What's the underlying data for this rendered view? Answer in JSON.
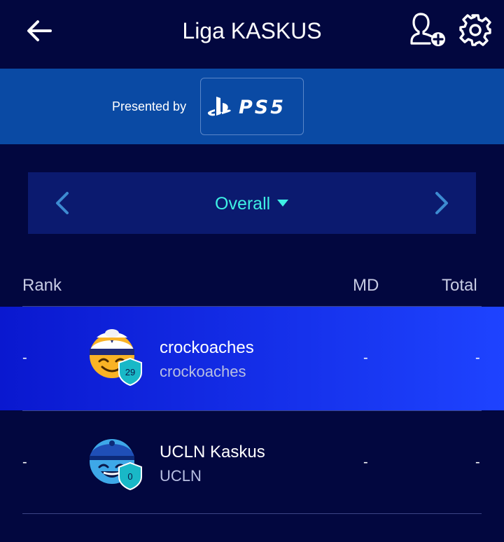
{
  "header": {
    "title": "Liga KASKUS",
    "icons": [
      "arrow-left-icon",
      "add-user-icon",
      "gear-icon"
    ]
  },
  "sponsor": {
    "presented_by": "Presented by",
    "logo_text": "PS5"
  },
  "selector": {
    "label": "Overall"
  },
  "table": {
    "columns": [
      "Rank",
      "MD",
      "Total"
    ],
    "rows": [
      {
        "rank": "-",
        "name": "crockoaches",
        "team": "crockoaches",
        "badge": "29",
        "md": "-",
        "total": "-",
        "highlighted": true
      },
      {
        "rank": "-",
        "name": "UCLN Kaskus",
        "team": "UCLN",
        "badge": "0",
        "md": "-",
        "total": "-",
        "highlighted": false
      }
    ]
  },
  "colors": {
    "background": "#02073f",
    "sponsor_bar": "#0a4aa4",
    "selector_bg": "#0b1a6f",
    "accent_cyan": "#3ef0e4",
    "highlight_row": "#1433f0"
  }
}
